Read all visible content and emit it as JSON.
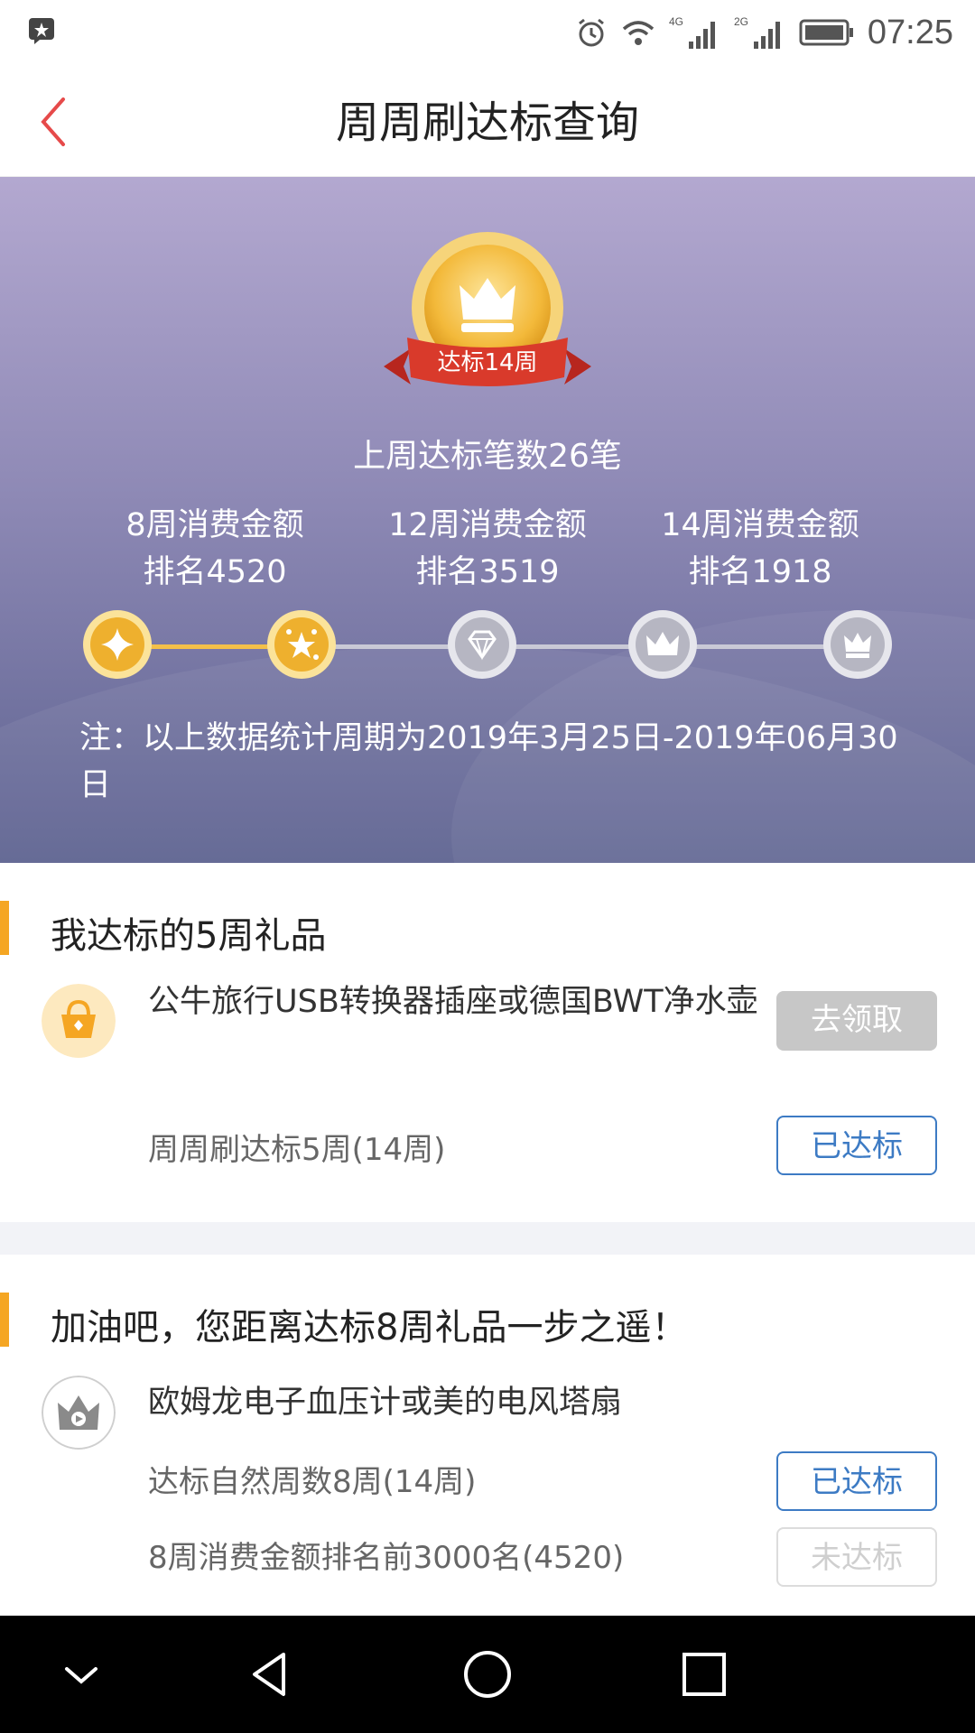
{
  "status_bar": {
    "time": "07:25",
    "network_1": "4G",
    "network_2": "2G"
  },
  "header": {
    "title": "周周刷达标查询"
  },
  "banner": {
    "medal_label": "达标14周",
    "last_week": "上周达标笔数26笔",
    "ranks": [
      {
        "label": "8周消费金额",
        "value": "排名4520"
      },
      {
        "label": "12周消费金额",
        "value": "排名3519"
      },
      {
        "label": "14周消费金额",
        "value": "排名1918"
      }
    ],
    "progress_nodes": [
      "sparkle",
      "stars",
      "diamond",
      "crown",
      "king"
    ],
    "progress_achieved": 2,
    "note": "注：以上数据统计周期为2019年3月25日-2019年06月30日"
  },
  "section1": {
    "title": "我达标的5周礼品",
    "gift_name": "公牛旅行USB转换器插座或德国BWT净水壶",
    "claim_button": "去领取",
    "requirement": "周周刷达标5周(14周)",
    "status": "已达标"
  },
  "section2": {
    "title": "加油吧，您距离达标8周礼品一步之遥！",
    "gift_name": "欧姆龙电子血压计或美的电风塔扇",
    "requirement_1": "达标自然周数8周(14周)",
    "status_1": "已达标",
    "requirement_2": "8周消费金额排名前3000名(4520)",
    "status_2": "未达标"
  },
  "colors": {
    "accent": "#f5a623",
    "button_blue": "#3d7bc4",
    "banner_top": "#b3a8d0",
    "banner_bottom": "#5d6290"
  }
}
